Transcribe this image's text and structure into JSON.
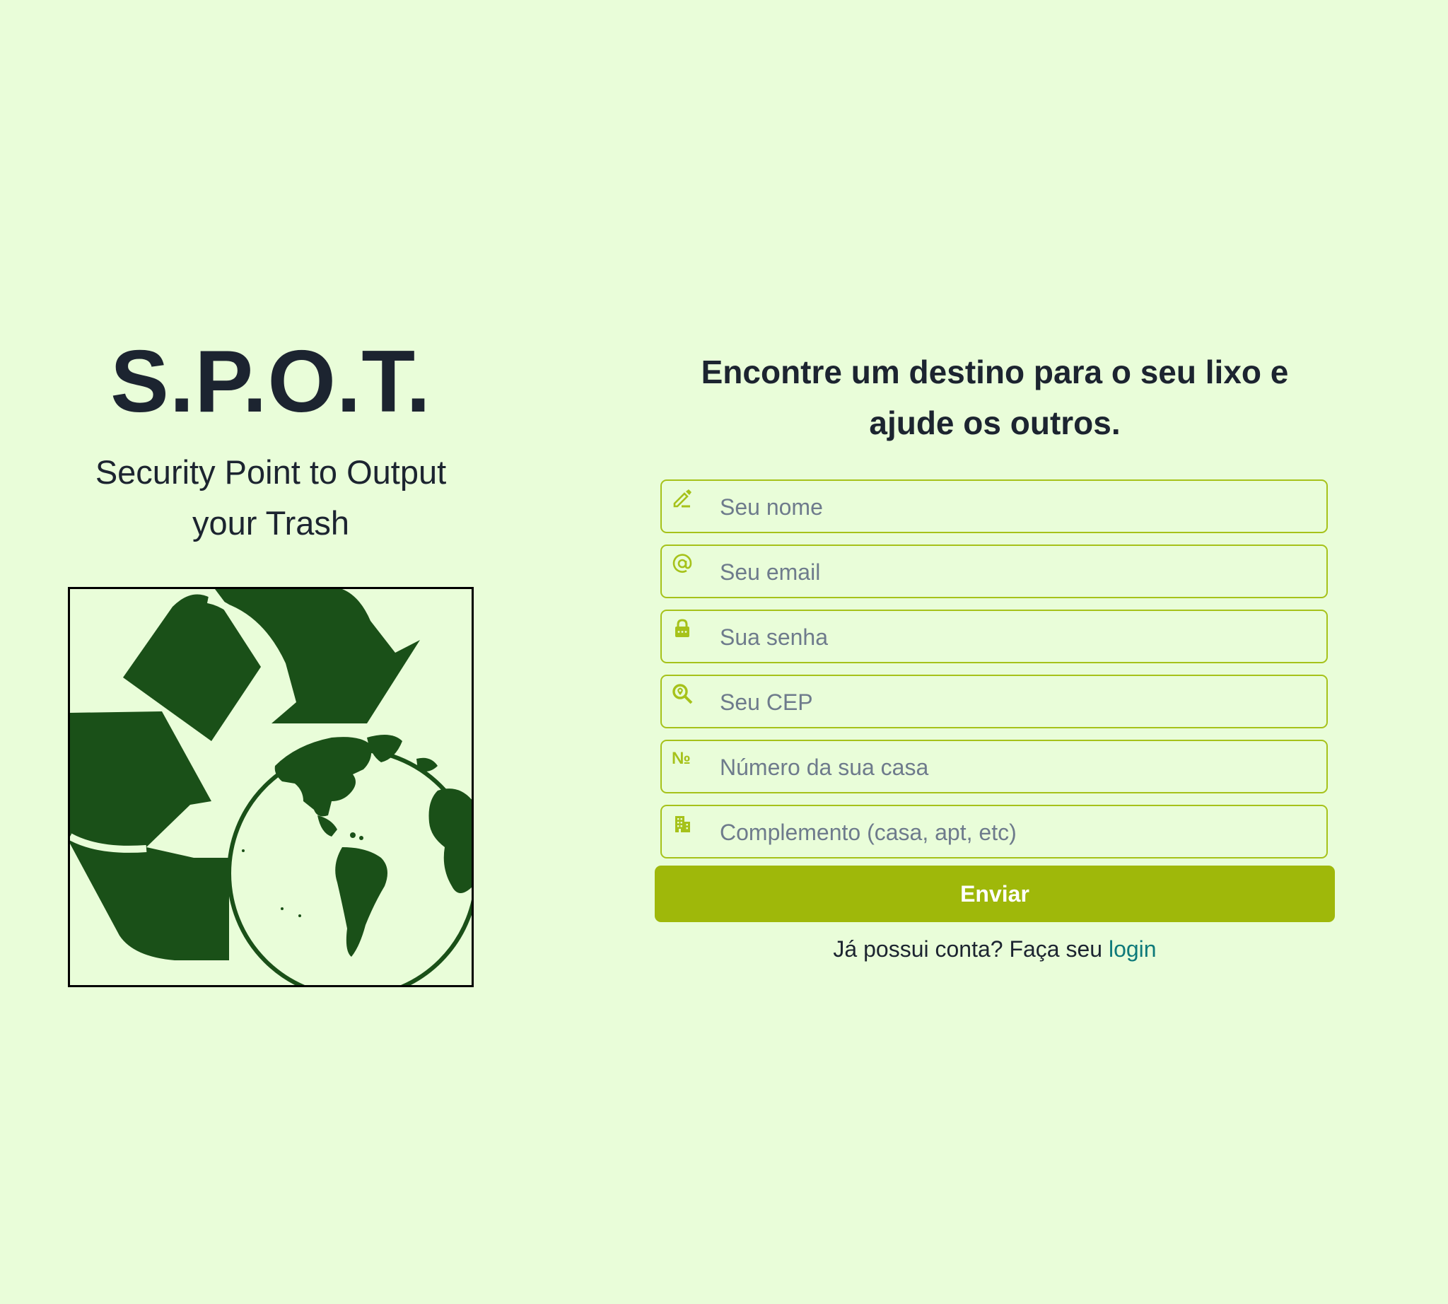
{
  "brand": {
    "title": "S.P.O.T.",
    "subtitle_line1": "Security Point to Output",
    "subtitle_line2": "your Trash",
    "logo_icon": "recycle-globe-logo"
  },
  "form": {
    "heading": "Encontre um destino para o seu lixo e ajude os outros.",
    "fields": [
      {
        "icon": "pencil-icon",
        "placeholder": "Seu nome",
        "value": ""
      },
      {
        "icon": "at-icon",
        "placeholder": "Seu email",
        "value": ""
      },
      {
        "icon": "lock-icon",
        "placeholder": "Sua senha",
        "value": ""
      },
      {
        "icon": "search-location-icon",
        "placeholder": "Seu CEP",
        "value": ""
      },
      {
        "icon": "numero-icon",
        "glyph": "№",
        "placeholder": "Número da sua casa",
        "value": ""
      },
      {
        "icon": "building-icon",
        "placeholder": "Complemento (casa, apt, etc)",
        "value": ""
      }
    ],
    "submit_label": "Enviar",
    "login_prompt": "Já possui conta? Faça seu",
    "login_link": "login"
  },
  "colors": {
    "background": "#e9fdd9",
    "accent": "#a6c21a",
    "button": "#9fb80a",
    "link": "#0e7a7a",
    "logo_green": "#1a5018"
  }
}
